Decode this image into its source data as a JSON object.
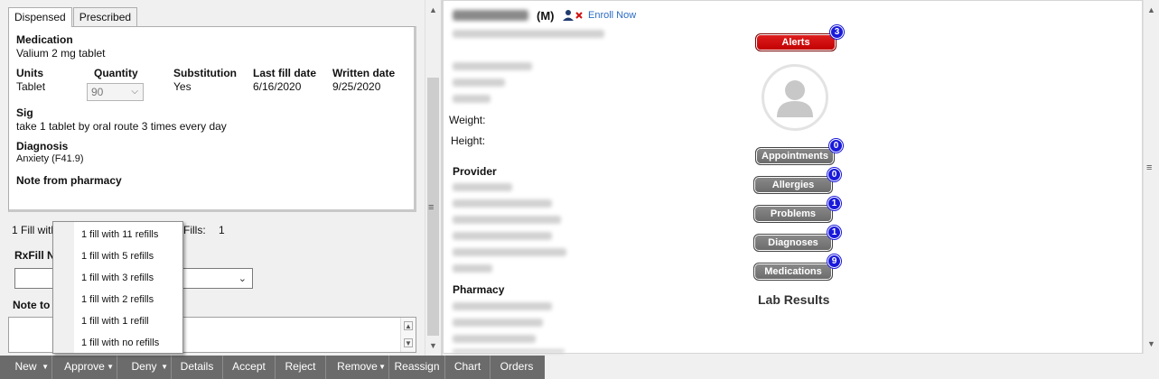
{
  "tabs": {
    "dispensed": "Dispensed",
    "prescribed": "Prescribed"
  },
  "rx": {
    "medication_label": "Medication",
    "medication_value": "Valium 2 mg tablet",
    "units_label": "Units",
    "units_value": "Tablet",
    "quantity_label": "Quantity",
    "quantity_value": "90",
    "substitution_label": "Substitution",
    "substitution_value": "Yes",
    "last_fill_label": "Last fill date",
    "last_fill_value": "6/16/2020",
    "written_label": "Written date",
    "written_value": "9/25/2020",
    "sig_label": "Sig",
    "sig_value": "take 1 tablet by oral route 3 times every day",
    "diagnosis_label": "Diagnosis",
    "diagnosis_value": "Anxiety (F41.9)",
    "note_pharmacy_label": "Note from pharmacy"
  },
  "fill": {
    "prefix": "1 Fill with",
    "fills_label": "Fills:",
    "fills_value": "1",
    "rxfill_label": "RxFill No",
    "note_label": "Note to"
  },
  "refill_options": [
    "1 fill with 11 refills",
    "1 fill with 5 refills",
    "1 fill with 3 refills",
    "1 fill with 2 refills",
    "1 fill with 1 refill",
    "1 fill with no refills"
  ],
  "patient": {
    "sex": "(M)",
    "enroll": "Enroll Now",
    "weight_label": "Weight:",
    "height_label": "Height:",
    "provider_label": "Provider",
    "pharmacy_label": "Pharmacy",
    "lab_results": "Lab Results"
  },
  "badges": {
    "alerts_label": "Alerts",
    "alerts_count": "3",
    "appointments_label": "Appointments",
    "appointments_count": "0",
    "allergies_label": "Allergies",
    "allergies_count": "0",
    "problems_label": "Problems",
    "problems_count": "1",
    "diagnoses_label": "Diagnoses",
    "diagnoses_count": "1",
    "medications_label": "Medications",
    "medications_count": "9"
  },
  "toolbar": {
    "new": "New",
    "approve": "Approve",
    "deny": "Deny",
    "details": "Details",
    "accept": "Accept",
    "reject": "Reject",
    "remove": "Remove",
    "reassign": "Reassign",
    "chart": "Chart",
    "orders": "Orders"
  },
  "colors": {
    "alert_red": "#d40000",
    "badge_blue": "#1a1adb",
    "toolbar_gray": "#6b6b6b",
    "link_blue": "#2b6cc4"
  }
}
